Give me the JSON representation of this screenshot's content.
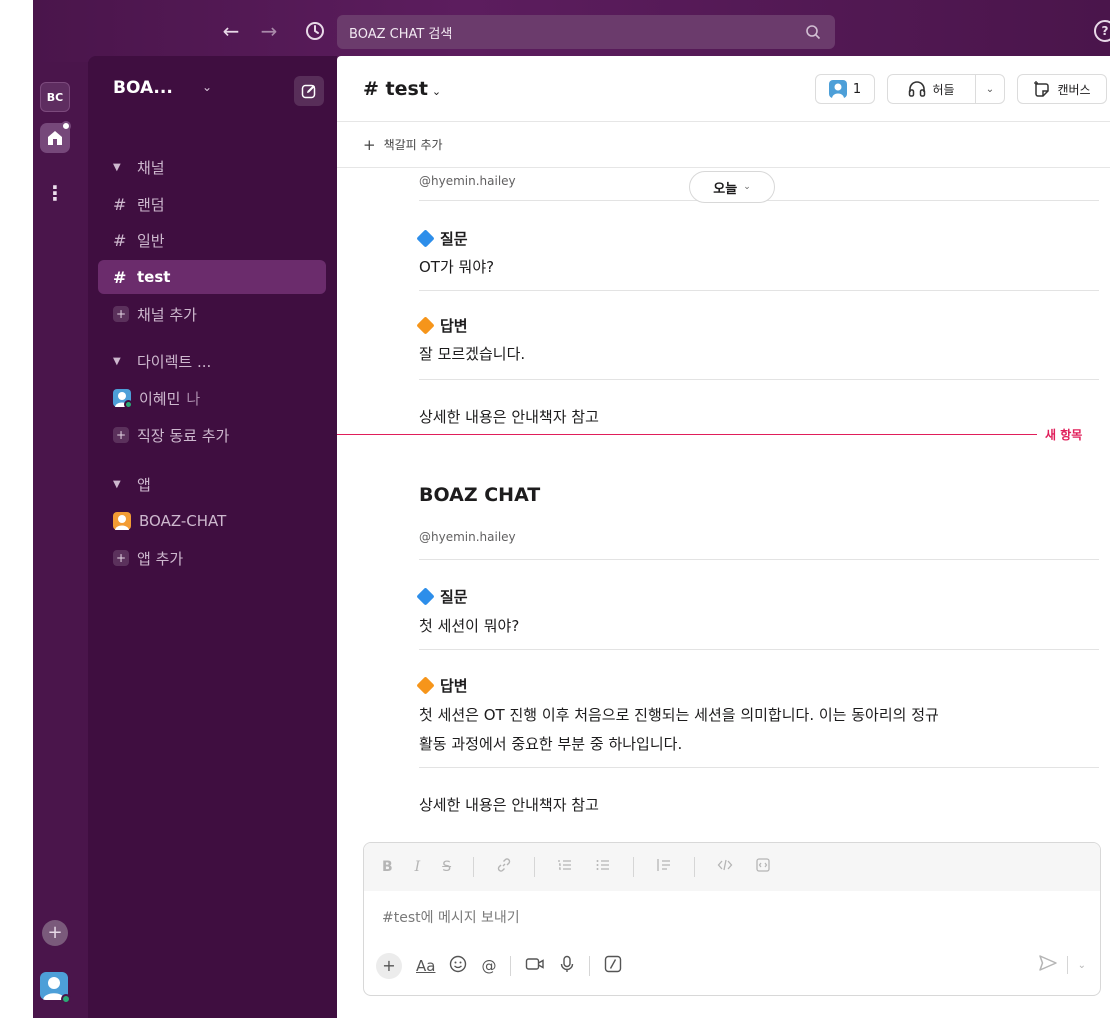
{
  "topbar": {
    "back": "←",
    "forward": "→",
    "search_placeholder": "BOAZ CHAT 검색",
    "help": "?"
  },
  "rail": {
    "workspace_initials": "BC",
    "more": "⋮",
    "add": "+"
  },
  "sidebar": {
    "workspace_name": "BOA...",
    "sections": {
      "channels_header": "채널",
      "channels": [
        "랜덤",
        "일반",
        "test"
      ],
      "add_channel": "채널 추가",
      "direct_header": "다이렉트 ...",
      "direct_user": "이혜민",
      "direct_user_suffix": "나",
      "add_coworker": "직장 동료 추가",
      "apps_header": "앱",
      "app_name": "BOAZ-CHAT",
      "add_app": "앱 추가"
    }
  },
  "channel": {
    "title": "# test",
    "member_count": "1",
    "huddle_label": "허들",
    "canvas_label": "캔버스",
    "add_bookmark": "책갈피 추가"
  },
  "messages": {
    "handle_1": "@hyemin.hailey",
    "today": "오늘",
    "q_label_1": "질문",
    "q_text_1": "OT가 뭐야?",
    "a_label_1": "답변",
    "a_text_1": "잘 모르겠습니다.",
    "ref_1": "상세한 내용은 안내책자 참고",
    "new_items": "새 항목",
    "app_title": "BOAZ CHAT",
    "handle_2": "@hyemin.hailey",
    "q_label_2": "질문",
    "q_text_2": "첫 세션이 뭐야?",
    "a_label_2": "답변",
    "a_text_2_line1": "첫 세션은 OT 진행 이후 처음으로 진행되는 세션을 의미합니다. 이는 동아리의 정규",
    "a_text_2_line2": "활동 과정에서 중요한 부분 중 하나입니다.",
    "ref_2": "상세한 내용은 안내책자 참고"
  },
  "composer": {
    "placeholder": "#test에 메시지 보내기",
    "fmt": [
      "B",
      "I",
      "S"
    ],
    "aa": "Aa",
    "at": "@"
  },
  "colors": {
    "aubergine": "#3f0e40",
    "active_channel": "#6b2c6c",
    "new_line": "#e01e5a",
    "blue_diamond": "#2d8eea",
    "orange_diamond": "#f6951a"
  }
}
